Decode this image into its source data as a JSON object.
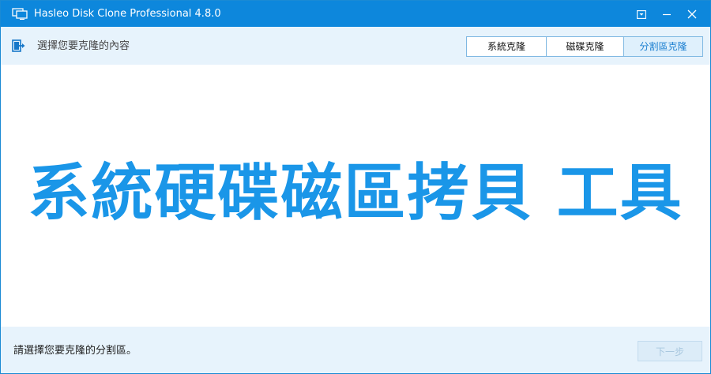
{
  "window": {
    "title": "Hasleo Disk Clone Professional 4.8.0"
  },
  "toolbar": {
    "step_text": "選擇您要克隆的內容",
    "tabs": [
      {
        "label": "系統克隆"
      },
      {
        "label": "磁碟克隆"
      },
      {
        "label": "分割區克隆"
      }
    ]
  },
  "main": {
    "banner_text": "系統硬碟磁區拷貝 工具"
  },
  "footer": {
    "hint_text": "請選擇您要克隆的分割區。",
    "next_label": "下一步"
  },
  "colors": {
    "titlebar": "#0d87dc",
    "accent_text": "#1a96e8",
    "strip_background": "#e7f3fc"
  }
}
